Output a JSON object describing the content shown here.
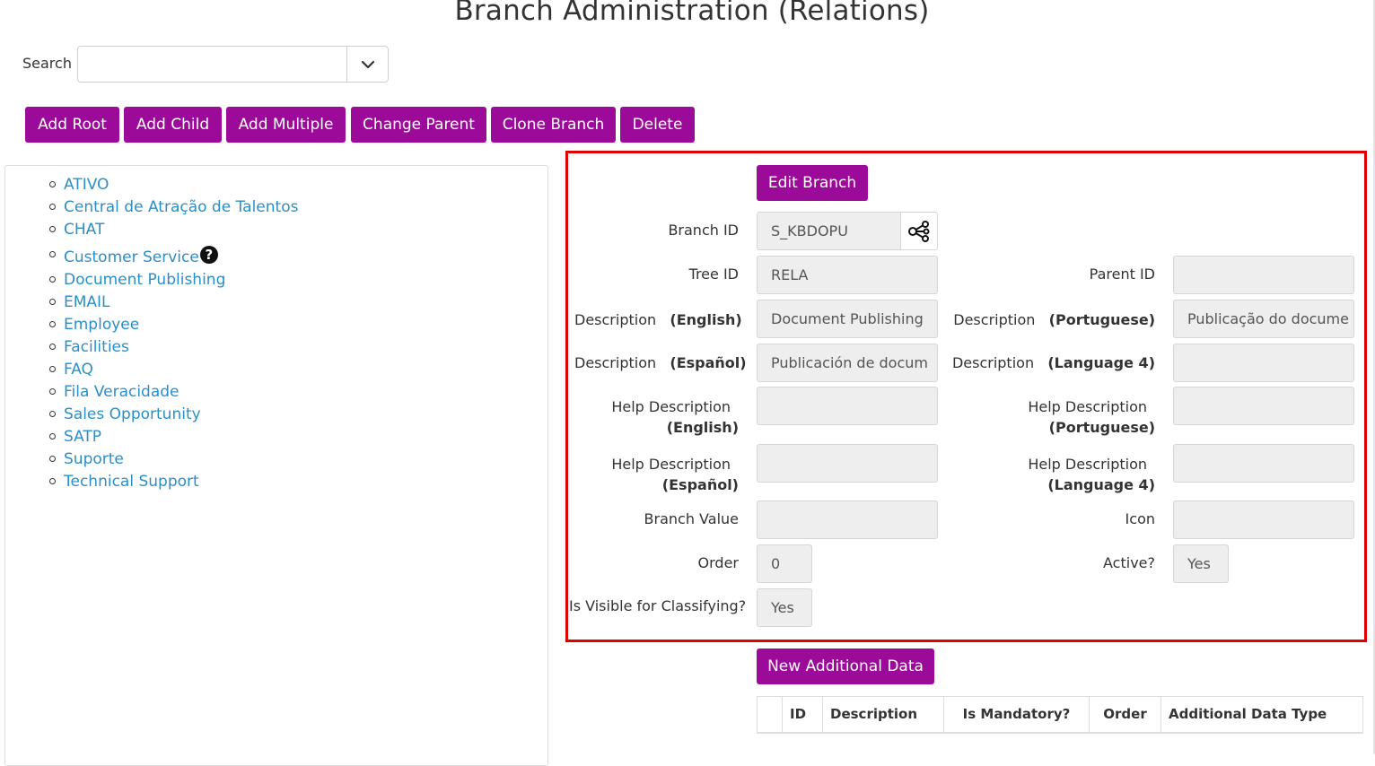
{
  "page": {
    "title": "Branch Administration (Relations)"
  },
  "search": {
    "label": "Search",
    "value": "",
    "dropdown_icon": "chevron-down-icon"
  },
  "toolbar": {
    "add_root": "Add Root",
    "add_child": "Add Child",
    "add_multiple": "Add Multiple",
    "change_parent": "Change Parent",
    "clone_branch": "Clone Branch",
    "delete": "Delete"
  },
  "tree": {
    "items": [
      {
        "label": "ATIVO"
      },
      {
        "label": "Central de Atração de Talentos"
      },
      {
        "label": "CHAT"
      },
      {
        "label": "Customer Service",
        "help": "?"
      },
      {
        "label": "Document Publishing"
      },
      {
        "label": "EMAIL"
      },
      {
        "label": "Employee"
      },
      {
        "label": "Facilities"
      },
      {
        "label": "FAQ"
      },
      {
        "label": "Fila Veracidade"
      },
      {
        "label": "Sales Opportunity"
      },
      {
        "label": "SATP"
      },
      {
        "label": "Suporte"
      },
      {
        "label": "Technical Support"
      }
    ]
  },
  "edit": {
    "edit_button": "Edit Branch",
    "branch_id": {
      "label": "Branch ID",
      "value": "S_KBDOPU",
      "icon": "share-nodes-icon"
    },
    "tree_id": {
      "label": "Tree ID",
      "value": "RELA"
    },
    "parent_id": {
      "label": "Parent ID",
      "value": ""
    },
    "desc_english": {
      "label": "Description",
      "lang": "(English)",
      "value": "Document Publishing"
    },
    "desc_portuguese": {
      "label": "Description",
      "lang": "(Portuguese)",
      "value": "Publicação do docume"
    },
    "desc_espanol": {
      "label": "Description",
      "lang": "(Español)",
      "value": "Publicación de docum"
    },
    "desc_language4": {
      "label": "Description",
      "lang": "(Language 4)",
      "value": ""
    },
    "help_english": {
      "label": "Help Description",
      "lang": "(English)",
      "value": ""
    },
    "help_portuguese": {
      "label": "Help Description",
      "lang": "(Portuguese)",
      "value": ""
    },
    "help_espanol": {
      "label": "Help Description",
      "lang": "(Español)",
      "value": ""
    },
    "help_language4": {
      "label": "Help Description",
      "lang": "(Language 4)",
      "value": ""
    },
    "branch_value": {
      "label": "Branch Value",
      "value": ""
    },
    "icon_field": {
      "label": "Icon",
      "value": ""
    },
    "order": {
      "label": "Order",
      "value": "0"
    },
    "active": {
      "label": "Active?",
      "value": "Yes"
    },
    "visible": {
      "label": "Is Visible for Classifying?",
      "value": "Yes"
    }
  },
  "additional": {
    "new_button": "New Additional Data",
    "columns": [
      "",
      "ID",
      "Description",
      "Is Mandatory?",
      "Order",
      "Additional Data Type"
    ]
  },
  "colors": {
    "button": "#9c0a9a",
    "link": "#2a8fc9",
    "highlight_border": "#e10000",
    "field_bg": "#eeeeee"
  }
}
